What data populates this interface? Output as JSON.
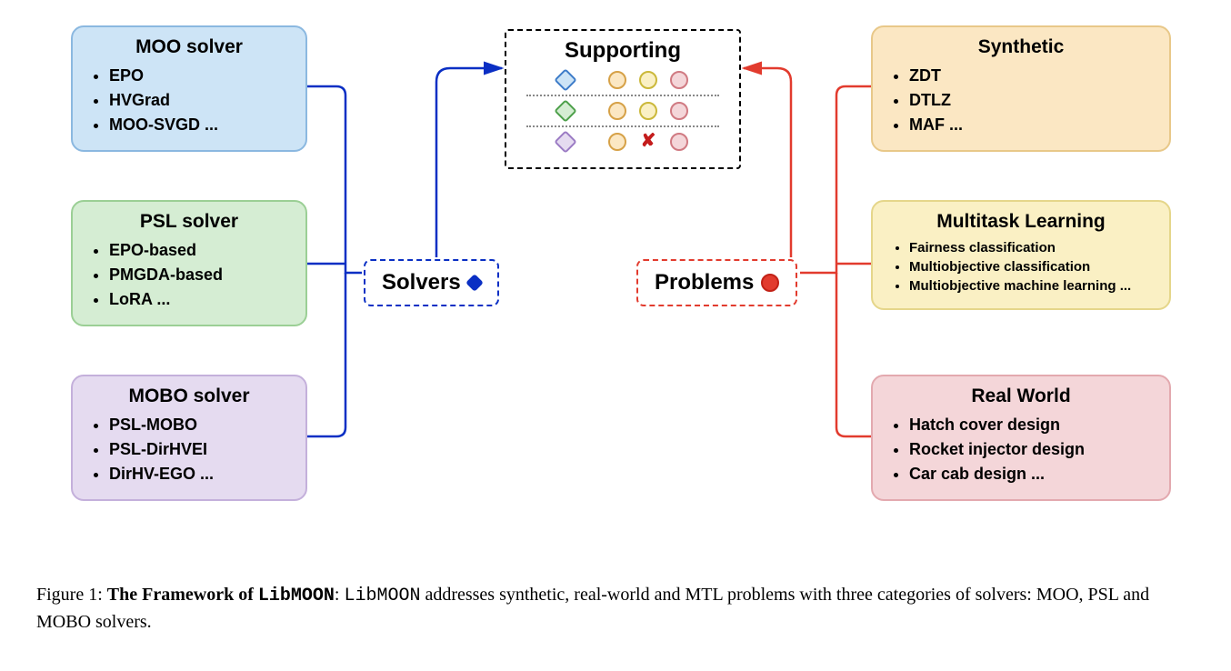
{
  "solvers": {
    "label": "Solvers",
    "moo": {
      "title": "MOO solver",
      "items": [
        "EPO",
        "HVGrad",
        "MOO-SVGD ..."
      ]
    },
    "psl": {
      "title": "PSL solver",
      "items": [
        "EPO-based",
        "PMGDA-based",
        "LoRA ..."
      ]
    },
    "mobo": {
      "title": "MOBO solver",
      "items": [
        "PSL-MOBO",
        "PSL-DirHVEI",
        "DirHV-EGO ..."
      ]
    }
  },
  "problems": {
    "label": "Problems",
    "synthetic": {
      "title": "Synthetic",
      "items": [
        "ZDT",
        "DTLZ",
        "MAF ..."
      ]
    },
    "mtl": {
      "title": "Multitask Learning",
      "items": [
        "Fairness classification",
        "Multiobjective classification",
        "Multiobjective machine learning ..."
      ]
    },
    "realworld": {
      "title": "Real World",
      "items": [
        "Hatch cover design",
        "Rocket injector design",
        "Car cab design ..."
      ]
    }
  },
  "supporting": {
    "title": "Supporting"
  },
  "caption": {
    "prefix": "Figure 1: ",
    "bold_lead": "The Framework of ",
    "libname1": "LibMOON",
    "colon": ": ",
    "libname2": "LibMOON",
    "rest": " addresses synthetic, real-world and MTL problems with three categories of solvers: MOO, PSL and MOBO solvers."
  }
}
